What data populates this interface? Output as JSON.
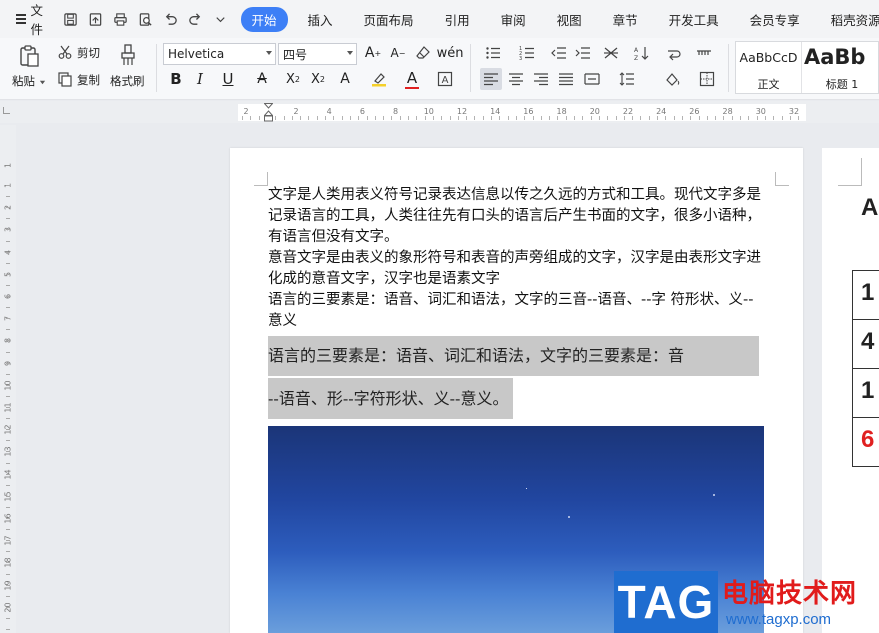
{
  "menu": {
    "file_label": "文件",
    "tabs": [
      "开始",
      "插入",
      "页面布局",
      "引用",
      "审阅",
      "视图",
      "章节",
      "开发工具",
      "会员专享",
      "稻壳资源"
    ],
    "active_tab": "开始"
  },
  "ribbon": {
    "paste_label": "粘贴",
    "cut_label": "剪切",
    "copy_label": "复制",
    "format_painter_label": "格式刷",
    "font_name": "Helvetica",
    "font_size": "四号",
    "styles": [
      {
        "sample": "AaBbCcD",
        "name": "正文"
      },
      {
        "sample": "AaBb",
        "name": "标题 1"
      }
    ],
    "font_color": "#e02020",
    "highlight_color": "#f5d02a"
  },
  "ruler": {
    "h_numbers": [
      "2",
      "2",
      "4",
      "6",
      "8",
      "10",
      "12",
      "14",
      "16",
      "18",
      "20",
      "22",
      "24",
      "26",
      "28",
      "30",
      "32"
    ],
    "v_numbers": [
      "1",
      "1",
      "2",
      "3",
      "4",
      "5",
      "6",
      "7",
      "8",
      "9",
      "10",
      "11",
      "12",
      "13",
      "14",
      "15",
      "16",
      "17",
      "18",
      "19",
      "20"
    ]
  },
  "document": {
    "paragraphs": [
      "文字是人类用表义符号记录表达信息以传之久远的方式和工具。现代文字多是记录语言的工具，人类往往先有口头的语言后产生书面的文字，很多小语种，有语言但没有文字。",
      "意音文字是由表义的象形符号和表音的声旁组成的文字，汉字是由表形文字进化成的意音文字，汉字也是语素文字",
      "语言的三要素是：语音、词汇和语法，文字的三音--语音、--字  符形状、义--意义"
    ],
    "highlight_line1": "语言的三要素是：语音、词汇和语法，文字的三要素是：音",
    "highlight_line2": "--语音、形--字符形状、义--意义。"
  },
  "page2": {
    "title_fragment": "A",
    "table_cells": [
      "1",
      "4",
      "1",
      "6"
    ],
    "last_cell_color": "#e02020"
  },
  "watermark": {
    "tag": "TAG",
    "site_name": "电脑技术网",
    "url": "www.tagxp.com"
  }
}
